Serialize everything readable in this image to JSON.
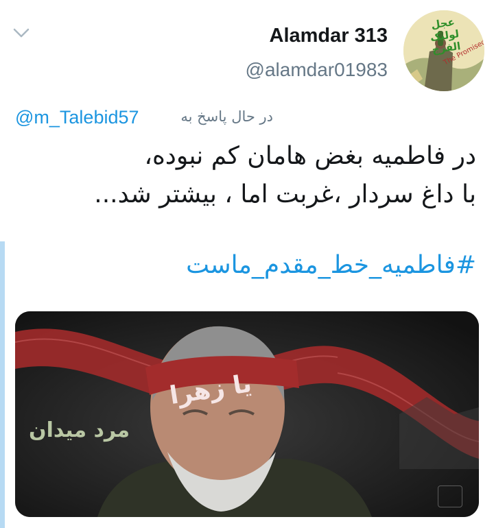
{
  "tweet": {
    "author_name": "Alamdar 313",
    "author_handle": "@alamdar01983",
    "reply_prefix": "در حال پاسخ به",
    "reply_to_handle": "@m_Talebid57",
    "text_lines": [
      "در فاطمیه بغض هامان کم نبوده،",
      "با داغ سردار ،غربت اما ، بیشتر شد..."
    ],
    "hashtag": "#فاطمیه_خط_مقدم_ماست"
  },
  "avatar": {
    "logo_text": "عجل لولیک الفرج",
    "slogan": "The Promised Saviour"
  },
  "media": {
    "banner_text": "یا زهرا",
    "poster_title": "مرد میدان"
  },
  "icons": {
    "menu": "chevron-down-icon"
  },
  "colors": {
    "link": "#1b95e0",
    "secondary_text": "#657786",
    "thread_line": "#b7daf3"
  }
}
